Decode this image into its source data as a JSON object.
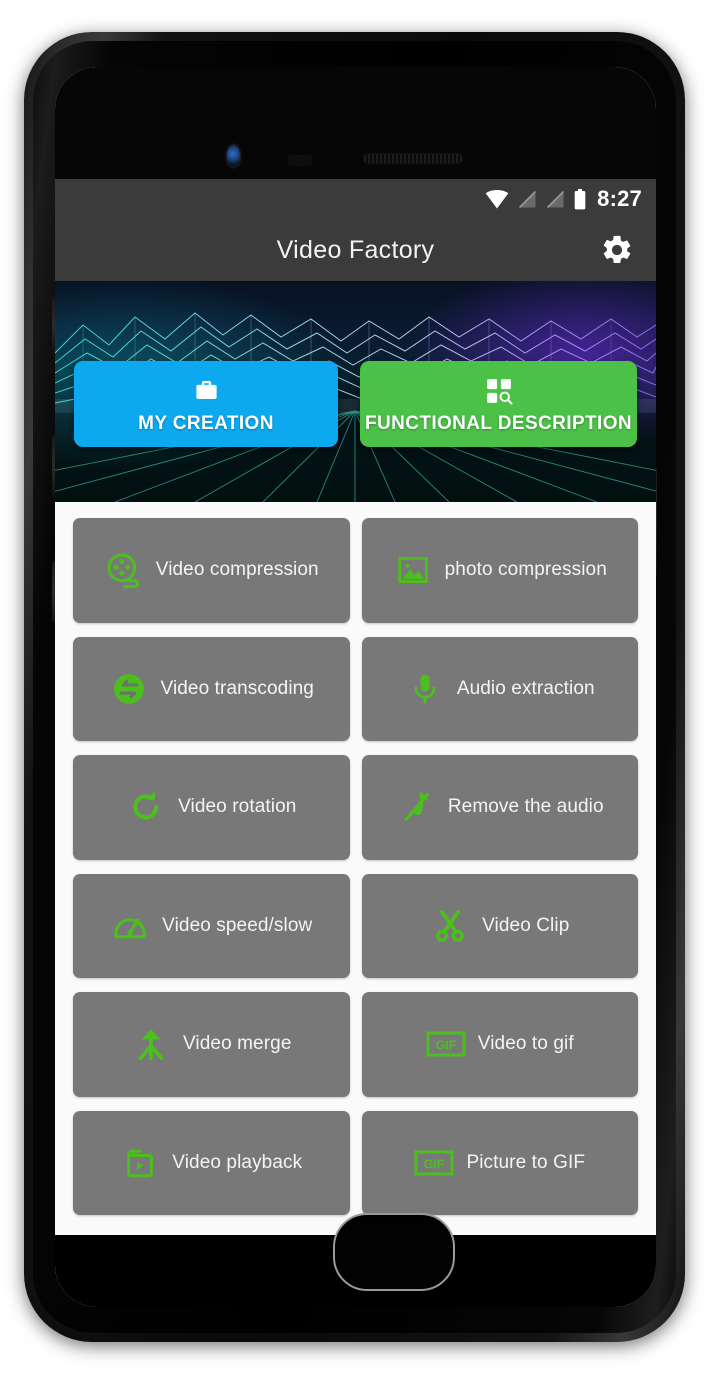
{
  "colors": {
    "app_bar": "#3b3b3b",
    "accent_blue": "#0CA9F0",
    "accent_green": "#4BC247",
    "icon_green": "#4CBE1E",
    "tile_gray": "#787878",
    "page_bg": "#fafafa"
  },
  "status_bar": {
    "clock": "8:27",
    "icons": [
      "wifi-icon",
      "signal-empty-icon",
      "signal-empty-icon",
      "battery-icon"
    ]
  },
  "app_bar": {
    "title": "Video Factory",
    "settings_icon": "gear-icon"
  },
  "banner": {
    "buttons": [
      {
        "label": "MY CREATION",
        "icon": "briefcase-icon",
        "color": "#0CA9F0"
      },
      {
        "label": "FUNCTIONAL DESCRIPTION",
        "icon": "grid-search-icon",
        "color": "#4BC247"
      }
    ]
  },
  "features": [
    {
      "label": "Video compression",
      "icon": "film-reel-icon"
    },
    {
      "label": "photo compression",
      "icon": "image-icon"
    },
    {
      "label": "Video transcoding",
      "icon": "exchange-arrows-icon"
    },
    {
      "label": "Audio extraction",
      "icon": "microphone-icon"
    },
    {
      "label": "Video rotation",
      "icon": "rotate-clockwise-icon"
    },
    {
      "label": "Remove the audio",
      "icon": "music-note-slash-icon"
    },
    {
      "label": "Video speed/slow",
      "icon": "speedometer-icon"
    },
    {
      "label": "Video Clip",
      "icon": "scissors-icon"
    },
    {
      "label": "Video merge",
      "icon": "merge-arrow-icon"
    },
    {
      "label": "Video to gif",
      "icon": "gif-box-icon"
    },
    {
      "label": "Video playback",
      "icon": "replay-box-icon"
    },
    {
      "label": "Picture to GIF",
      "icon": "gif-box-icon"
    }
  ]
}
